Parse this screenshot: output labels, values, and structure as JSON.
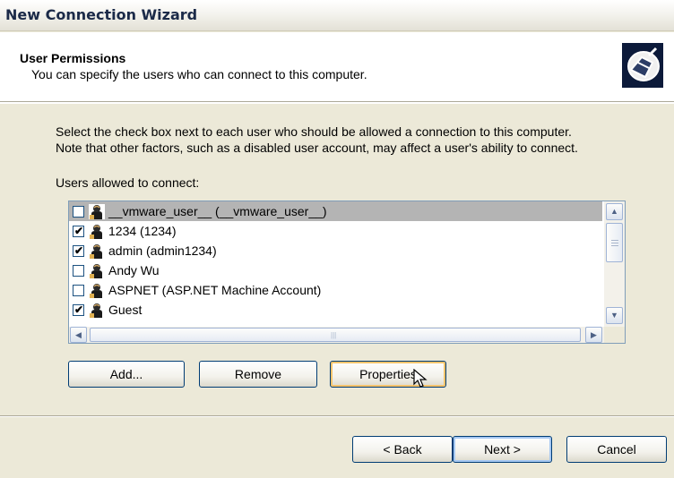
{
  "window": {
    "title": "New Connection Wizard"
  },
  "header": {
    "title": "User Permissions",
    "subtitle": "You can specify the users who can connect to this computer.",
    "icon": "network-plug-icon"
  },
  "description": {
    "line1": "Select the check box next to each user who should be allowed a connection to this computer.",
    "line2": "Note that other factors, such as a disabled user account, may affect a user's ability to connect."
  },
  "users": {
    "label": "Users allowed to connect:",
    "items": [
      {
        "name": "__vmware_user__ (__vmware_user__)",
        "checked": false,
        "selected": true
      },
      {
        "name": "1234 (1234)",
        "checked": true,
        "selected": false
      },
      {
        "name": "admin (admin1234)",
        "checked": true,
        "selected": false
      },
      {
        "name": "Andy Wu",
        "checked": false,
        "selected": false
      },
      {
        "name": "ASPNET (ASP.NET Machine Account)",
        "checked": false,
        "selected": false
      },
      {
        "name": "Guest",
        "checked": true,
        "selected": false
      }
    ]
  },
  "actions": {
    "add": "Add...",
    "remove": "Remove",
    "properties": "Properties"
  },
  "nav": {
    "back": "< Back",
    "next": "Next >",
    "cancel": "Cancel"
  },
  "colors": {
    "selected_row": "#b4b4b4",
    "focus_ring": "#f7c46c",
    "default_ring": "#a6c8f2"
  }
}
